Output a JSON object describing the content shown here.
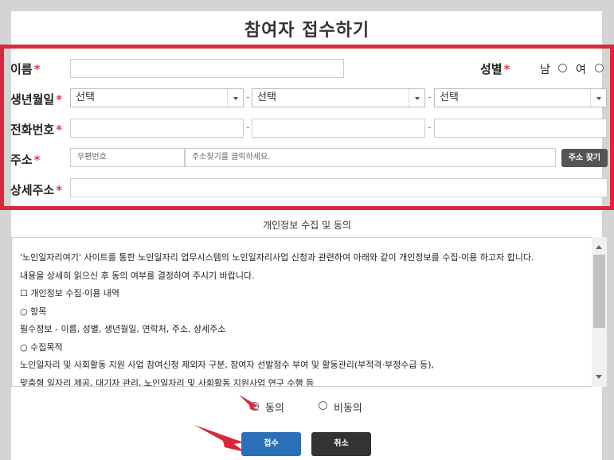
{
  "form": {
    "title": "참여자 접수하기",
    "name_label": "이름",
    "gender_label": "성별",
    "gender_male": "남",
    "gender_female": "여",
    "birth_label": "생년월일",
    "birth_year": "선택",
    "birth_month": "선택",
    "birth_day": "선택",
    "phone_label": "전화번호",
    "address_label": "주소",
    "zip_placeholder": "우편번호",
    "address_placeholder": "주소찾기를 클릭하세요.",
    "address_button": "주소 찾기",
    "detail_label": "상세주소",
    "required_mark": "*",
    "dash": "-"
  },
  "privacy": {
    "title": "개인정보 수집 및 동의",
    "lines": [
      "'노인일자리여기' 사이트를 통한 노인일자리 업무시스템의 노인일자리사업 신청과 관련하여 아래와 같이 개인정보를 수집·이용 하고자 합니다.",
      "내용을 상세히 읽으신 후 동의 여부를 결정하여 주시기 바랍니다.",
      "☐ 개인정보 수집·이용 내역",
      "○ 항목",
      "필수정보 - 이름, 성별, 생년월일, 연락처, 주소, 상세주소",
      "○ 수집목적",
      "노인일자리 및 사회활동 지원 사업 참여신청 제외자 구분, 참여자 선발점수 부여 및 활동관리(부적격·부정수급 등),",
      "맞춤형 일자리 제공, 대기자 관리, 노인일자리 및 사회활동 지원사업 연구 수행 등"
    ],
    "agree": "동의",
    "disagree": "비동의"
  },
  "buttons": {
    "submit": "접수",
    "cancel": "취소"
  },
  "colors": {
    "highlight": "#d9283a",
    "submit": "#2a6fb8",
    "cancel": "#333333",
    "required": "#e23a4a"
  }
}
